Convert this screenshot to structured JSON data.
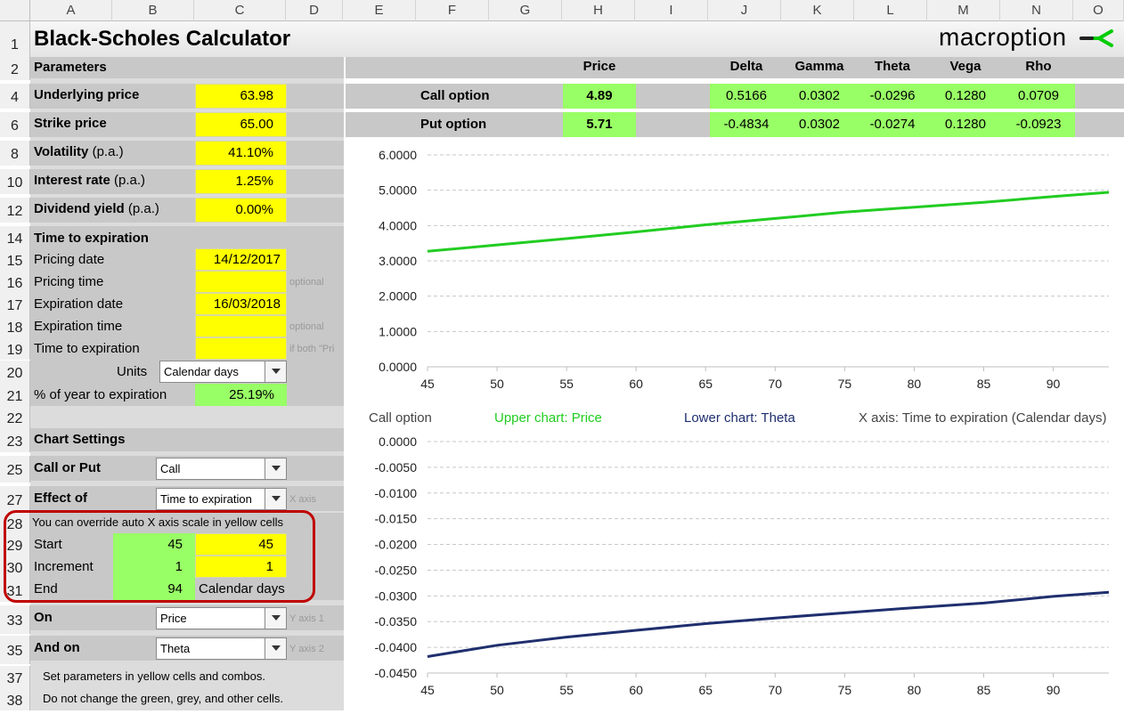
{
  "columns": [
    "A",
    "B",
    "C",
    "D",
    "E",
    "F",
    "G",
    "H",
    "I",
    "J",
    "K",
    "L",
    "M",
    "N",
    "O"
  ],
  "rows": [
    "1",
    "2",
    "4",
    "6",
    "8",
    "10",
    "12",
    "14",
    "15",
    "16",
    "17",
    "18",
    "19",
    "20",
    "21",
    "22",
    "23",
    "25",
    "27",
    "28",
    "29",
    "30",
    "31",
    "33",
    "35",
    "37",
    "38"
  ],
  "title": "Black-Scholes Calculator",
  "brand": "macroption",
  "brand_color": "#00cc00",
  "params": {
    "header": "Parameters",
    "underlying_label": "Underlying price",
    "underlying_value": "63.98",
    "strike_label": "Strike price",
    "strike_value": "65.00",
    "vol_label": "Volatility",
    "vol_suffix": "(p.a.)",
    "vol_value": "41.10%",
    "rate_label": "Interest rate",
    "rate_suffix": "(p.a.)",
    "rate_value": "1.25%",
    "div_label": "Dividend yield",
    "div_suffix": "(p.a.)",
    "div_value": "0.00%"
  },
  "expiry": {
    "header": "Time to expiration",
    "pricing_date_label": "Pricing date",
    "pricing_date_value": "14/12/2017",
    "pricing_time_label": "Pricing time",
    "pricing_time_note": "optional",
    "exp_date_label": "Expiration date",
    "exp_date_value": "16/03/2018",
    "exp_time_label": "Expiration time",
    "exp_time_note": "optional",
    "tte_label": "Time to expiration",
    "tte_note": "if both \"Pri",
    "units_label": "Units",
    "units_value": "Calendar days",
    "pct_label": "% of year to expiration",
    "pct_value": "25.19%"
  },
  "chart_settings": {
    "header": "Chart Settings",
    "callput_label": "Call or Put",
    "callput_value": "Call",
    "effect_label": "Effect of",
    "effect_value": "Time to expiration",
    "effect_note": "X axis",
    "override_note": "You can override auto X axis scale in yellow cells",
    "start_label": "Start",
    "start_auto": "45",
    "start_override": "45",
    "inc_label": "Increment",
    "inc_auto": "1",
    "inc_override": "1",
    "end_label": "End",
    "end_auto": "94",
    "end_units": "Calendar days",
    "on_label": "On",
    "on_value": "Price",
    "on_note": "Y axis 1",
    "andon_label": "And on",
    "andon_value": "Theta",
    "andon_note": "Y axis 2",
    "note1": "Set parameters in yellow cells and combos.",
    "note2": "Do not change the green, grey, and other cells."
  },
  "results": {
    "headers": [
      "Price",
      "Delta",
      "Gamma",
      "Theta",
      "Vega",
      "Rho"
    ],
    "call": {
      "label": "Call option",
      "values": [
        "4.89",
        "0.5166",
        "0.0302",
        "-0.0296",
        "0.1280",
        "0.0709"
      ]
    },
    "put": {
      "label": "Put option",
      "values": [
        "5.71",
        "-0.4834",
        "0.0302",
        "-0.0274",
        "0.1280",
        "-0.0923"
      ]
    }
  },
  "legend": {
    "option": "Call option",
    "upper": "Upper chart: Price",
    "lower": "Lower chart: Theta",
    "xaxis": "X axis: Time to expiration (Calendar days)",
    "upper_color": "#22cc22",
    "lower_color": "#1f2f6e"
  },
  "chart_data": [
    {
      "type": "line",
      "x_range": [
        45,
        94
      ],
      "xlim": [
        45,
        94
      ],
      "ylim": [
        0,
        6
      ],
      "x_ticks": [
        "45",
        "50",
        "55",
        "60",
        "65",
        "70",
        "75",
        "80",
        "85",
        "90"
      ],
      "y_ticks": [
        "0.0000",
        "1.0000",
        "2.0000",
        "3.0000",
        "4.0000",
        "5.0000",
        "6.0000"
      ],
      "x": [
        45,
        50,
        55,
        60,
        65,
        70,
        75,
        80,
        85,
        90,
        94
      ],
      "y": [
        3.27,
        3.45,
        3.63,
        3.82,
        4.02,
        4.2,
        4.38,
        4.52,
        4.66,
        4.82,
        4.94
      ],
      "color": "#22cc22",
      "grid": true
    },
    {
      "type": "line",
      "xlim": [
        45,
        94
      ],
      "ylim": [
        -0.045,
        0
      ],
      "x_ticks": [
        "45",
        "50",
        "55",
        "60",
        "65",
        "70",
        "75",
        "80",
        "85",
        "90"
      ],
      "y_ticks": [
        "0.0000",
        "-0.0050",
        "-0.0100",
        "-0.0150",
        "-0.0200",
        "-0.0250",
        "-0.0300",
        "-0.0350",
        "-0.0400",
        "-0.0450"
      ],
      "x": [
        45,
        50,
        55,
        60,
        65,
        70,
        75,
        80,
        85,
        90,
        94
      ],
      "y": [
        -0.0418,
        -0.0396,
        -0.038,
        -0.0367,
        -0.0354,
        -0.0343,
        -0.0333,
        -0.0323,
        -0.0314,
        -0.0301,
        -0.0293
      ],
      "color": "#1f2f6e",
      "grid": true
    }
  ]
}
